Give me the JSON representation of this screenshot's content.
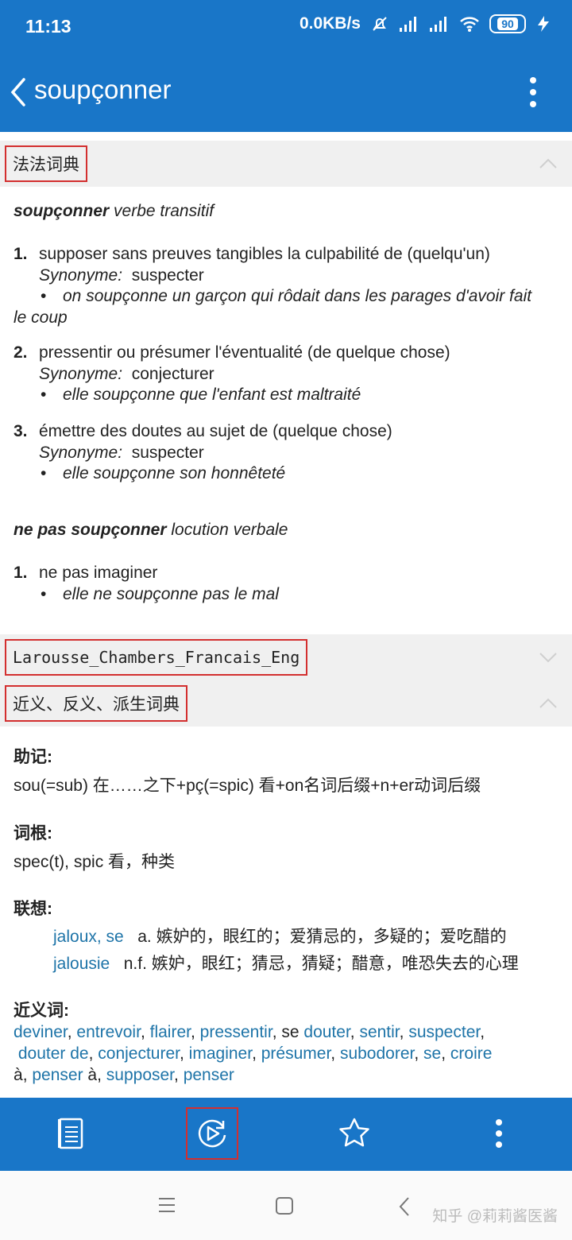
{
  "status_bar": {
    "time": "11:13",
    "speed": "0.0KB/s",
    "battery": "90"
  },
  "app_bar": {
    "title": "soupçonner"
  },
  "sections": {
    "dict1": "法法词典",
    "dict2": "Larousse_Chambers_Francais_Eng",
    "dict3": "近义、反义、派生词典"
  },
  "entry": {
    "word": "soupçonner",
    "pos": "verbe transitif",
    "synonym_label": "Synonyme:",
    "senses": [
      {
        "num": "1.",
        "definition": "supposer sans preuves tangibles la culpabilité de (quelqu'un)",
        "synonym": "suspecter",
        "example_line1": "on soupçonne un garçon qui rôdait dans les parages d'avoir fait",
        "example_line2": "le coup"
      },
      {
        "num": "2.",
        "definition": "pressentir ou présumer l'éventualité (de quelque chose)",
        "synonym": "conjecturer",
        "example_line1": "elle soupçonne que l'enfant est maltraité"
      },
      {
        "num": "3.",
        "definition": "émettre des doutes au sujet de (quelque chose)",
        "synonym": "suspecter",
        "example_line1": "elle soupçonne son honnêteté"
      }
    ],
    "locution": {
      "phrase": "ne pas soupçonner",
      "pos": "locution verbale",
      "num": "1.",
      "definition": "ne pas imaginer",
      "example": "elle ne soupçonne pas le mal"
    }
  },
  "derivation": {
    "mnemonic_label": "助记:",
    "mnemonic_text": "sou(=sub) 在……之下+pç(=spic) 看+on名词后缀+n+er动词后缀",
    "root_label": "词根:",
    "root_text": "spec(t), spic 看，种类",
    "assoc_label": "联想:",
    "assoc": [
      {
        "word": "jaloux, se",
        "gloss": "a. 嫉妒的，眼红的；爱猜忌的，多疑的；爱吃醋的"
      },
      {
        "word": "jalousie",
        "gloss": "n.f. 嫉妒，眼红；猜忌，猜疑；醋意，唯恐失去的心理"
      }
    ],
    "synonyms_label": "近义词:",
    "synonyms_line1": [
      "deviner",
      "entrevoir",
      "flairer",
      "pressentir"
    ],
    "se_prefix": "se",
    "synonyms_line1b": [
      "douter",
      "sentir",
      "suspecter"
    ],
    "synonyms_line2": [
      "douter de",
      "conjecturer",
      "imaginer",
      "présumer",
      "subodorer",
      "se",
      "croire"
    ],
    "a_word": "à",
    "synonyms_line3": [
      "penser",
      "supposer",
      "penser"
    ]
  },
  "watermark": "知乎 @莉莉酱医酱",
  "colors": {
    "primary": "#1976c8",
    "link": "#1e74a8",
    "highlight_border": "#d32f2f"
  },
  "icons": {
    "back": "chevron-left-icon",
    "menu": "more-vertical-icon",
    "list": "list-icon",
    "play": "replay-icon",
    "star": "star-icon"
  }
}
